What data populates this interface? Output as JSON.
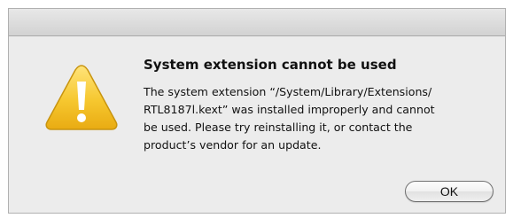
{
  "dialog": {
    "title": "System extension cannot be used",
    "message_lines": [
      "The system extension “/System/Library/Extensions/",
      "RTL8187l.kext” was installed improperly and cannot",
      "be used. Please try reinstalling it, or contact the",
      "product’s vendor for an update."
    ],
    "icon": "warning-icon",
    "ok_label": "OK"
  },
  "colors": {
    "warning_fill": "#f5c631",
    "dialog_background": "#ececec"
  }
}
